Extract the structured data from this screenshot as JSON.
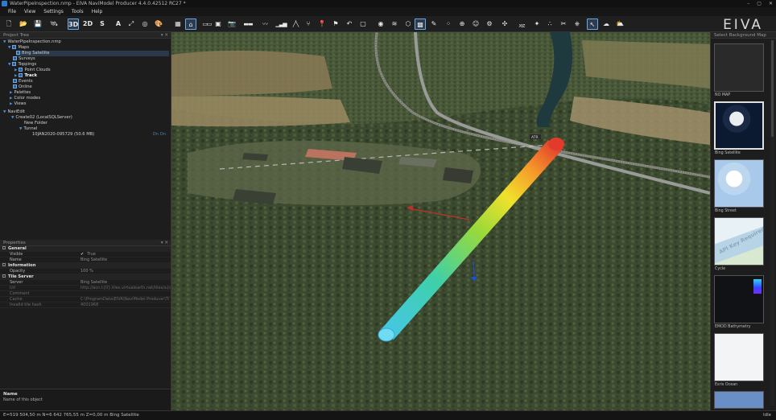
{
  "window": {
    "title": "WaterPipeInspection.nmp - EIVA NaviModel Producer 4.4.0.42512 RC27 *",
    "controls": [
      "–",
      "▢",
      "✕"
    ]
  },
  "menu": [
    "File",
    "View",
    "Settings",
    "Tools",
    "Help"
  ],
  "toolbar": {
    "btn_3d": "3D",
    "btn_2d": "2D",
    "btn_s": "S",
    "btn_a": "A",
    "xyz": "XYZ",
    "brand": "EIVA"
  },
  "project_tree": {
    "header": "Project Tree",
    "pin": "▾ ✕",
    "items": [
      {
        "label": "WaterPipeInspection.nmp"
      },
      {
        "label": "Maps"
      },
      {
        "label": "Bing Satellite"
      },
      {
        "label": "Surveys"
      },
      {
        "label": "Toppings"
      },
      {
        "label": "Point Clouds"
      },
      {
        "label": "Track"
      },
      {
        "label": "Events"
      },
      {
        "label": "Online"
      },
      {
        "label": "Palettes"
      },
      {
        "label": "Color modes"
      },
      {
        "label": "Views"
      },
      {
        "label": "NaviEdit"
      },
      {
        "label": "Create02 (LocalSQLServer)"
      },
      {
        "label": "New Folder"
      },
      {
        "label": "Tunnel"
      },
      {
        "label": "10JAN2020-095729 (50.6 MB)",
        "tag": "On On"
      }
    ]
  },
  "properties": {
    "header": "Properties",
    "sections": [
      {
        "title": "General",
        "rows": [
          {
            "k": "Visible",
            "v": "True",
            "check": "✔"
          },
          {
            "k": "Name",
            "v": "Bing Satellite"
          }
        ]
      },
      {
        "title": "Information",
        "rows": [
          {
            "k": "Opacity",
            "v": "100 %"
          }
        ]
      },
      {
        "title": "Tile Server",
        "rows": [
          {
            "k": "Server",
            "v": "Bing Satellite"
          },
          {
            "k": "Url",
            "v": "http://ecn.t{0}.tiles.virtualearth.net/tiles/a{q}.jpeg?g="
          },
          {
            "k": "Comment",
            "v": ""
          },
          {
            "k": "Cache",
            "v": "C:\\ProgramData\\EIVA\\NaviModel Producer\\Ti"
          },
          {
            "k": "Invalid tile hash",
            "v": "4001968"
          }
        ]
      }
    ],
    "desc_title": "Name",
    "desc_text": "Name of this object"
  },
  "background_maps": {
    "header": "Select Background Map",
    "items": [
      {
        "label": "NO MAP"
      },
      {
        "label": "Bing Satellite"
      },
      {
        "label": "Bing Street"
      },
      {
        "label": "Cycle",
        "watermark": "API Key Required"
      },
      {
        "label": "EMOD Bathymetry"
      },
      {
        "label": "Esris Ocean"
      }
    ]
  },
  "status": {
    "left": "E=519 504,50 m N=6 642 765,55 m Z=0,00 m Bing Satellite",
    "right": "Idle"
  },
  "viewport": {
    "road_sign": "ATR"
  },
  "colors": {
    "accent": "#4a90d9",
    "panel": "#1d1d1d",
    "pipe_start": "#45c6ea",
    "pipe_end": "#e23b2c"
  }
}
